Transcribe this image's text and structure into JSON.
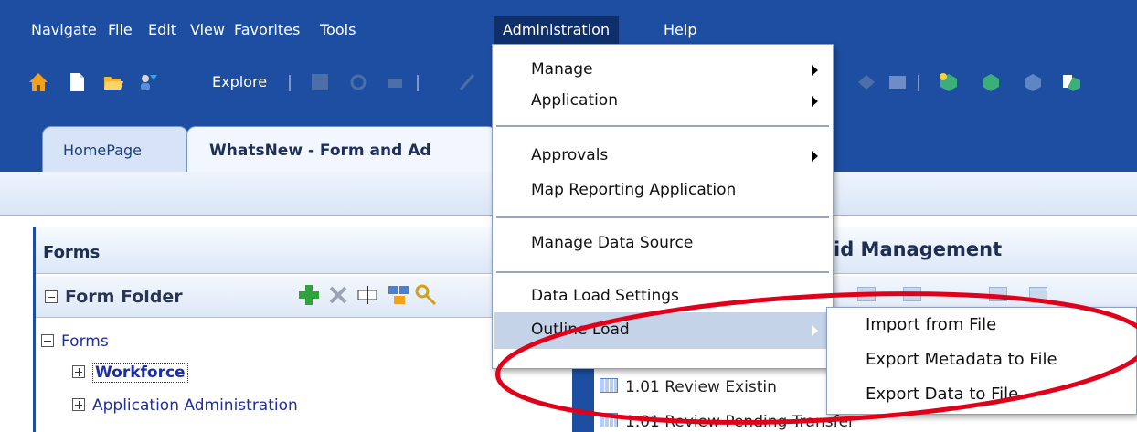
{
  "menubar": {
    "items": [
      "Navigate",
      "File",
      "Edit",
      "View",
      "Favorites",
      "Tools",
      "Administration",
      "Help"
    ]
  },
  "toolbar": {
    "explore_label": "Explore"
  },
  "tabs": [
    {
      "label": "HomePage"
    },
    {
      "label": "WhatsNew - Form and Ad"
    }
  ],
  "forms_panel": {
    "title": "Forms",
    "folder_title": "Form Folder",
    "tree": [
      "Forms",
      "Workforce",
      "Application Administration"
    ]
  },
  "right_panel": {
    "title": "id Management"
  },
  "form_list": [
    "1.01 Review Existin",
    "1.01 Review Pending Transfer"
  ],
  "admin_menu": {
    "items": [
      {
        "label": "Manage",
        "submenu": true
      },
      {
        "label": "Application",
        "submenu": true
      },
      {
        "label": "Approvals",
        "submenu": true
      },
      {
        "label": "Map Reporting Application",
        "submenu": false
      },
      {
        "label": "Manage Data Source",
        "submenu": false
      },
      {
        "label": "Data Load Settings",
        "submenu": false
      },
      {
        "label": "Outline Load",
        "submenu": true
      }
    ]
  },
  "outline_submenu": {
    "items": [
      "Import from File",
      "Export Metadata to File",
      "Export Data to File"
    ]
  },
  "colors": {
    "frame_blue": "#1d4ea1",
    "highlight": "#c4d3e8",
    "annotation_red": "#e0001a"
  }
}
